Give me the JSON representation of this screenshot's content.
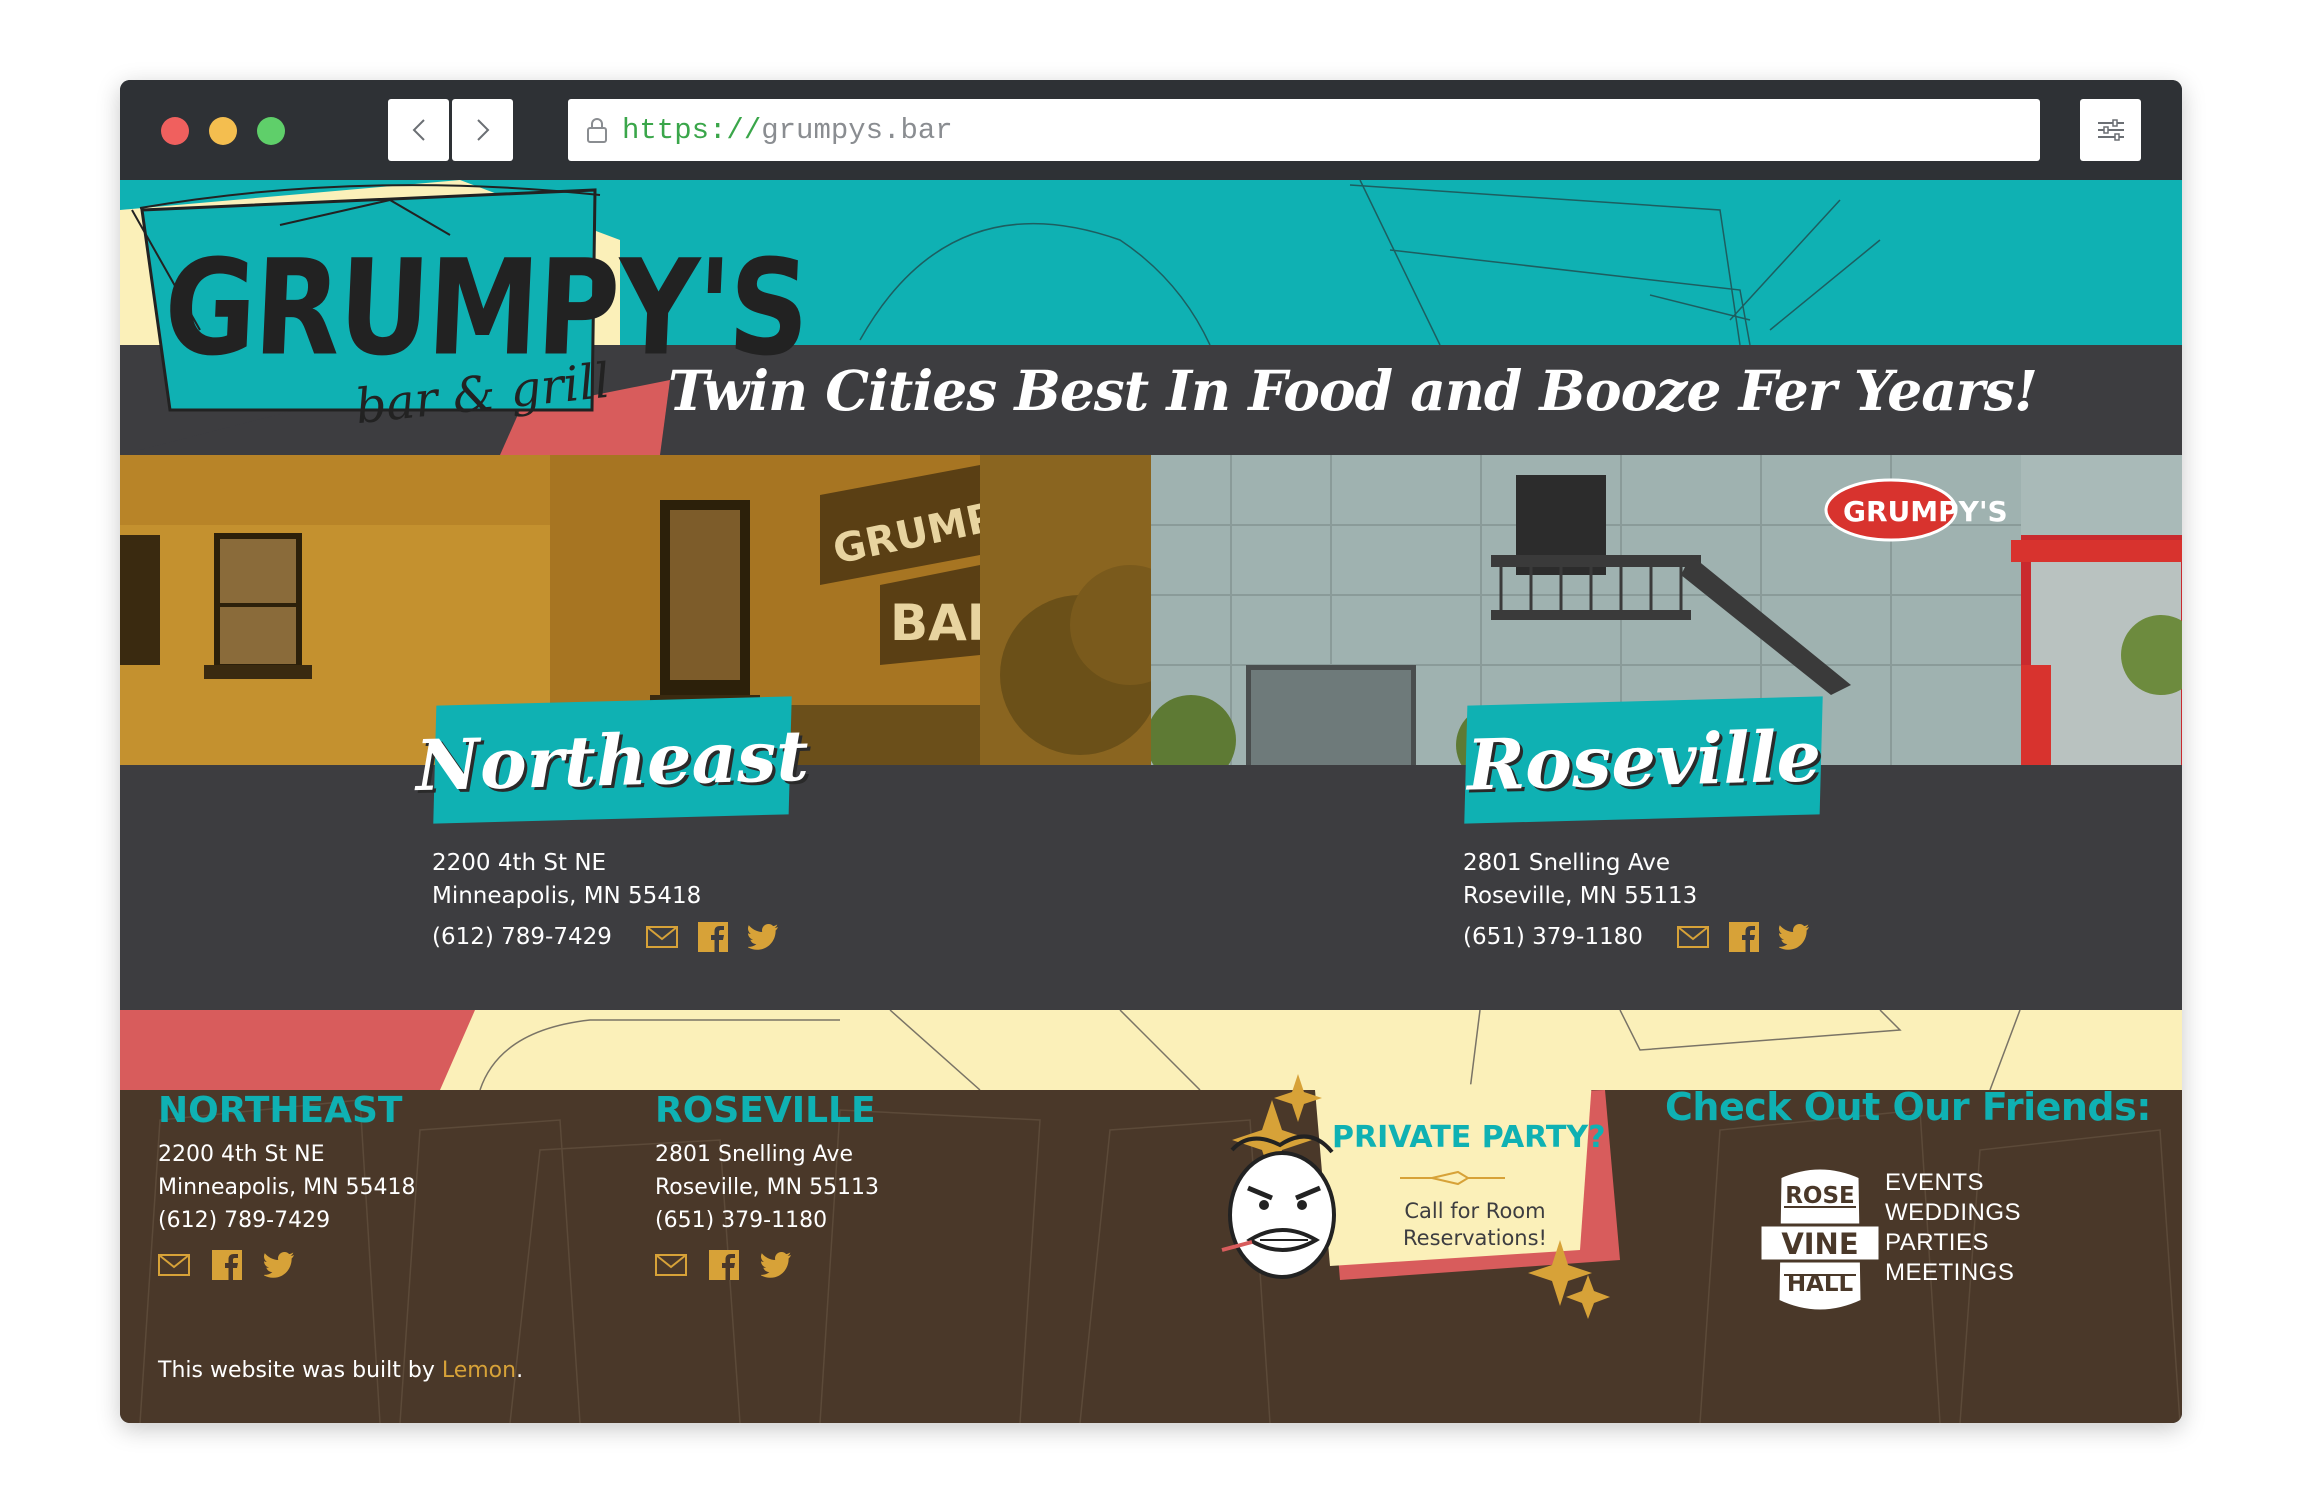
{
  "browser": {
    "url_scheme": "https://",
    "url_host": "grumpys.bar"
  },
  "brand": {
    "logo_text": "GRUMPY'S",
    "logo_subtext": "bar & grill",
    "tagline": "Twin Cities Best In Food and Booze Fer Years!"
  },
  "locations": [
    {
      "badge": "Northeast",
      "address_line1": "2200 4th St NE",
      "address_line2": "Minneapolis, MN 55418",
      "phone": "(612) 789-7429",
      "photo_sign": "GRUMPY'S",
      "photo_sign2": "BAR"
    },
    {
      "badge": "Roseville",
      "address_line1": "2801 Snelling Ave",
      "address_line2": "Roseville, MN 55113",
      "phone": "(651) 379-1180",
      "photo_sign": "GRUMPY'S"
    }
  ],
  "footer": {
    "northeast": {
      "heading": "NORTHEAST",
      "line1": "2200 4th St NE",
      "line2": "Minneapolis, MN 55418",
      "phone": "(612) 789-7429"
    },
    "roseville": {
      "heading": "ROSEVILLE",
      "line1": "2801 Snelling Ave",
      "line2": "Roseville, MN 55113",
      "phone": "(651) 379-1180"
    },
    "private_party": {
      "title": "PRIVATE PARTY?",
      "subtitle": "Call for Room Reservations!"
    },
    "friends": {
      "heading": "Check Out Our Friends:",
      "logo_lines": [
        "ROSE",
        "VINE",
        "HALL"
      ],
      "items": [
        "EVENTS",
        "WEDDINGS",
        "PARTIES",
        "MEETINGS"
      ]
    },
    "credit_prefix": "This website was built by ",
    "credit_link": "Lemon",
    "credit_suffix": "."
  },
  "icons": [
    "lock-icon",
    "back-icon",
    "forward-icon",
    "settings-icon",
    "mail-icon",
    "facebook-icon",
    "twitter-icon"
  ],
  "colors": {
    "teal": "#0fb1b3",
    "charcoal": "#3d3d40",
    "cream": "#fbf0b9",
    "coral": "#d85c5c",
    "brown": "#4a3829",
    "gold": "#d7a238"
  }
}
